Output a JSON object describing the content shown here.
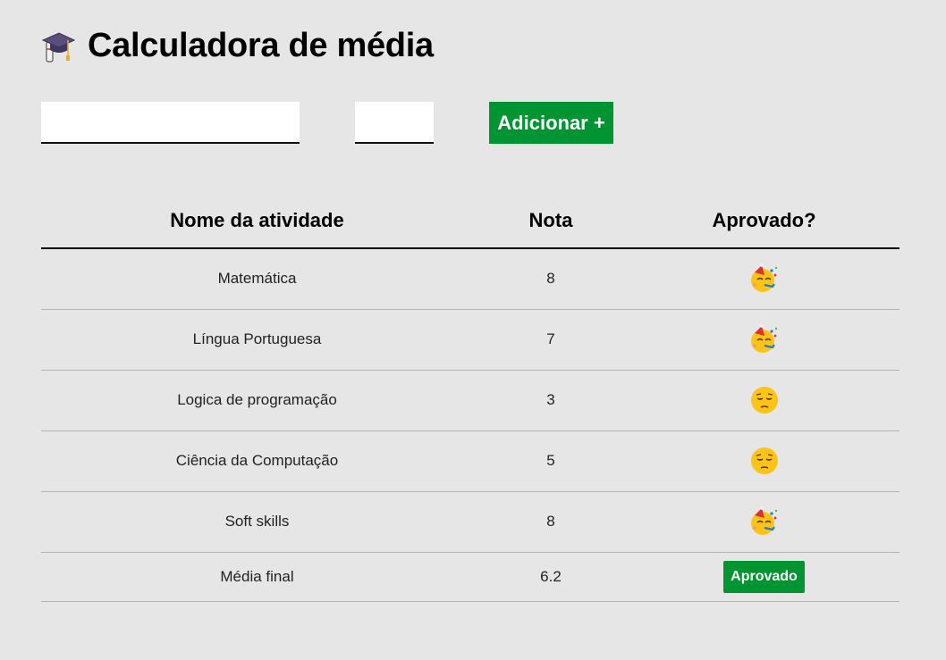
{
  "header": {
    "title": "Calculadora de média",
    "icon": "graduation-cap-icon"
  },
  "form": {
    "name_value": "",
    "grade_value": "",
    "add_label": "Adicionar +"
  },
  "table": {
    "headers": [
      "Nome da atividade",
      "Nota",
      "Aprovado?"
    ],
    "rows": [
      {
        "name": "Matemática",
        "grade": "8",
        "status_icon": "party-face-icon"
      },
      {
        "name": "Língua Portuguesa",
        "grade": "7",
        "status_icon": "party-face-icon"
      },
      {
        "name": "Logica de programação",
        "grade": "3",
        "status_icon": "pensive-face-icon"
      },
      {
        "name": "Ciência da Computação",
        "grade": "5",
        "status_icon": "pensive-face-icon"
      },
      {
        "name": "Soft skills",
        "grade": "8",
        "status_icon": "party-face-icon"
      }
    ],
    "final": {
      "label": "Média final",
      "value": "6.2",
      "status": "Aprovado"
    }
  },
  "colors": {
    "accent": "#009432",
    "background": "#e6e6e6"
  }
}
